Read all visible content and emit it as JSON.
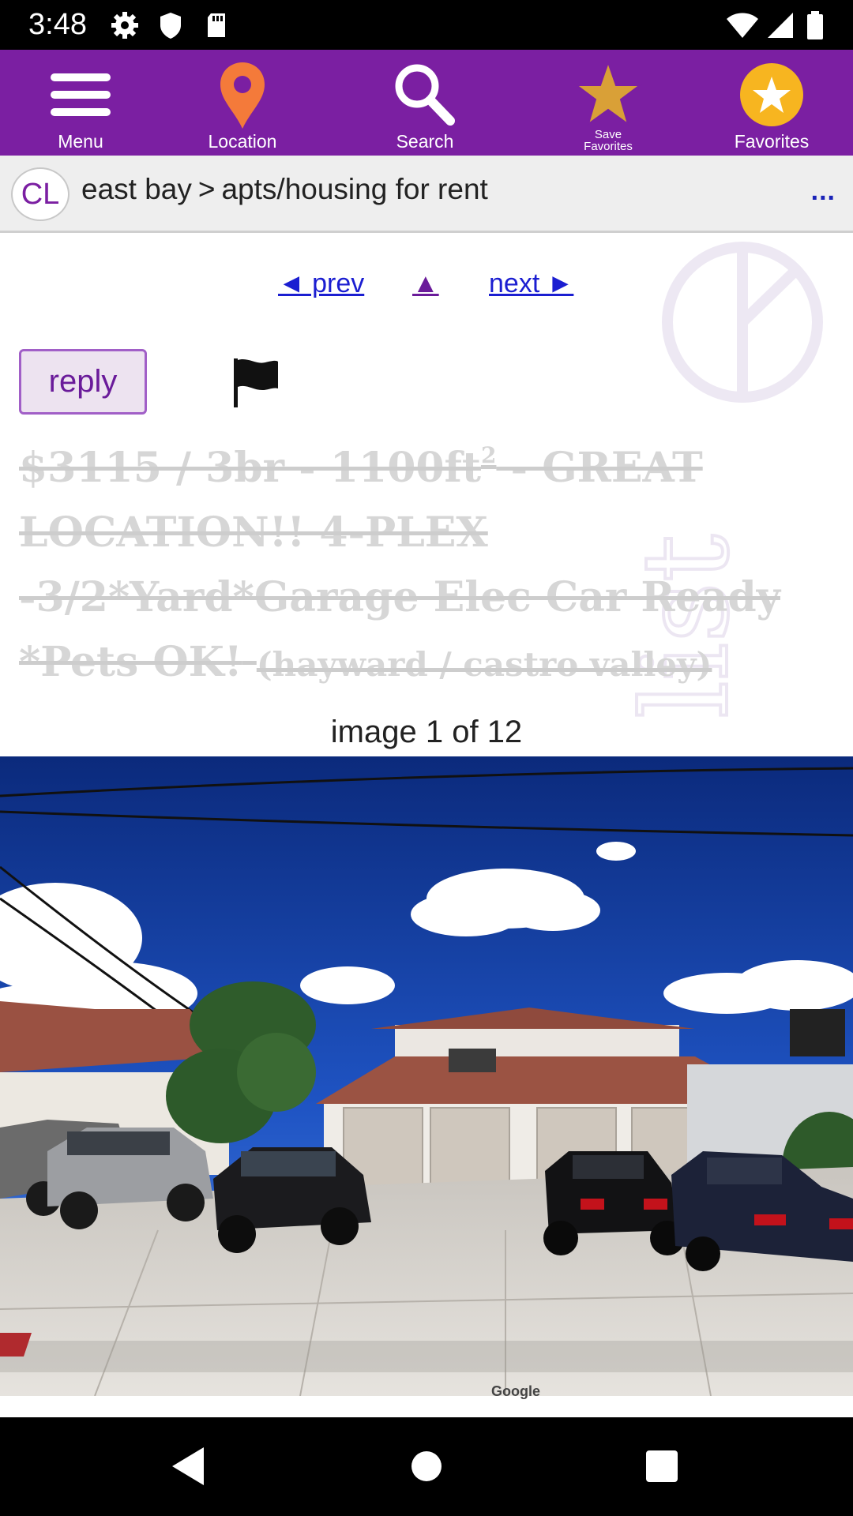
{
  "status_bar": {
    "time": "3:48",
    "left_icons": [
      "gear-icon",
      "shield-icon",
      "sd-card-icon"
    ],
    "right_icons": [
      "wifi-icon",
      "signal-icon",
      "battery-icon"
    ]
  },
  "toolbar": {
    "color": "#7b1fa2",
    "items": [
      {
        "label": "Menu",
        "icon": "hamburger-menu-icon"
      },
      {
        "label": "Location",
        "icon": "location-pin-icon"
      },
      {
        "label": "Search",
        "icon": "search-icon"
      },
      {
        "label": "Save\nFavorites",
        "label_line1": "Save",
        "label_line2": "Favorites",
        "icon": "star-icon"
      },
      {
        "label": "Favorites",
        "icon": "star-circle-icon"
      }
    ]
  },
  "breadcrumb": {
    "logo": "CL",
    "region": "east bay",
    "separator": ">",
    "category": "apts/housing for rent",
    "more": "..."
  },
  "navigation": {
    "prev": "◄ prev",
    "up": "▲",
    "next": "next ►"
  },
  "posting": {
    "reply_label": "reply",
    "title_main": "$3115 / 3br - 1100ft",
    "title_sup": "2",
    "title_rest": " - GREAT LOCATION!! 4-PLEX -3/2*Yard*Garage Elec Car Ready *Pets OK!",
    "location": "(hayward / castro valley)"
  },
  "gallery": {
    "caption": "image 1 of 12",
    "credit": "Google"
  },
  "nav_bar": {
    "buttons": [
      "back-icon",
      "home-icon",
      "recents-icon"
    ]
  }
}
